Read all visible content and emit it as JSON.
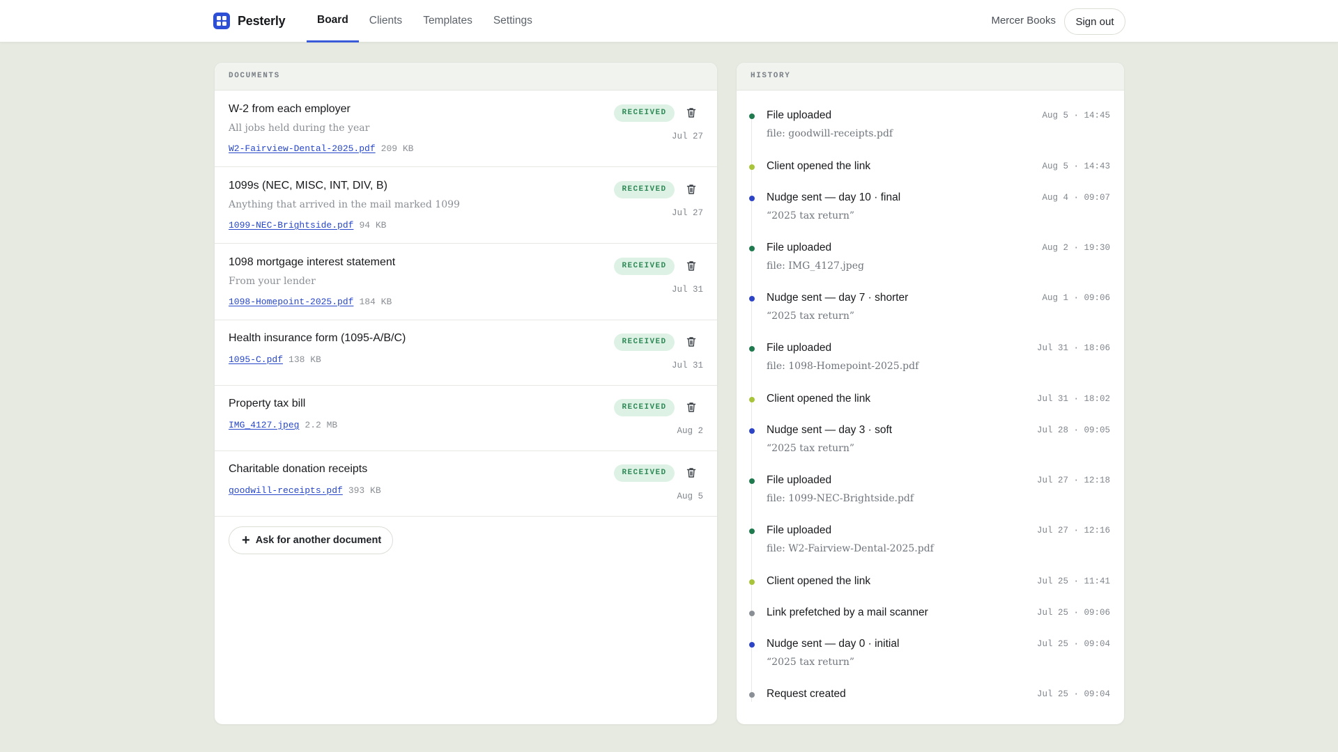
{
  "app": {
    "name": "Pesterly"
  },
  "nav": {
    "items": [
      {
        "label": "Board",
        "active": true
      },
      {
        "label": "Clients",
        "active": false
      },
      {
        "label": "Templates",
        "active": false
      },
      {
        "label": "Settings",
        "active": false
      }
    ],
    "account": "Mercer Books",
    "signout_label": "Sign out"
  },
  "documents": {
    "heading": "DOCUMENTS",
    "items": [
      {
        "title": "W-2 from each employer",
        "subtitle": "All jobs held during the year",
        "file": "W2-Fairview-Dental-2025.pdf",
        "size": "209 KB",
        "status": "RECEIVED",
        "date": "Jul 27"
      },
      {
        "title": "1099s (NEC, MISC, INT, DIV, B)",
        "subtitle": "Anything that arrived in the mail marked 1099",
        "file": "1099-NEC-Brightside.pdf",
        "size": "94 KB",
        "status": "RECEIVED",
        "date": "Jul 27"
      },
      {
        "title": "1098 mortgage interest statement",
        "subtitle": "From your lender",
        "file": "1098-Homepoint-2025.pdf",
        "size": "184 KB",
        "status": "RECEIVED",
        "date": "Jul 31"
      },
      {
        "title": "Health insurance form (1095-A/B/C)",
        "subtitle": "",
        "file": "1095-C.pdf",
        "size": "138 KB",
        "status": "RECEIVED",
        "date": "Jul 31"
      },
      {
        "title": "Property tax bill",
        "subtitle": "",
        "file": "IMG_4127.jpeg",
        "size": "2.2 MB",
        "status": "RECEIVED",
        "date": "Aug 2"
      },
      {
        "title": "Charitable donation receipts",
        "subtitle": "",
        "file": "goodwill-receipts.pdf",
        "size": "393 KB",
        "status": "RECEIVED",
        "date": "Aug 5"
      }
    ],
    "ask_label": "Ask for another document"
  },
  "history": {
    "heading": "HISTORY",
    "items": [
      {
        "title": "File uploaded",
        "detail": "file: goodwill-receipts.pdf",
        "time": "Aug 5 · 14:45",
        "kind": "upload"
      },
      {
        "title": "Client opened the link",
        "detail": "",
        "time": "Aug 5 · 14:43",
        "kind": "opened"
      },
      {
        "title": "Nudge sent — day 10 · final",
        "detail": "“2025 tax return”",
        "time": "Aug 4 · 09:07",
        "kind": "nudge"
      },
      {
        "title": "File uploaded",
        "detail": "file: IMG_4127.jpeg",
        "time": "Aug 2 · 19:30",
        "kind": "upload"
      },
      {
        "title": "Nudge sent — day 7 · shorter",
        "detail": "“2025 tax return”",
        "time": "Aug 1 · 09:06",
        "kind": "nudge"
      },
      {
        "title": "File uploaded",
        "detail": "file: 1098-Homepoint-2025.pdf",
        "time": "Jul 31 · 18:06",
        "kind": "upload"
      },
      {
        "title": "Client opened the link",
        "detail": "",
        "time": "Jul 31 · 18:02",
        "kind": "opened"
      },
      {
        "title": "Nudge sent — day 3 · soft",
        "detail": "“2025 tax return”",
        "time": "Jul 28 · 09:05",
        "kind": "nudge"
      },
      {
        "title": "File uploaded",
        "detail": "file: 1099-NEC-Brightside.pdf",
        "time": "Jul 27 · 12:18",
        "kind": "upload"
      },
      {
        "title": "File uploaded",
        "detail": "file: W2-Fairview-Dental-2025.pdf",
        "time": "Jul 27 · 12:16",
        "kind": "upload"
      },
      {
        "title": "Client opened the link",
        "detail": "",
        "time": "Jul 25 · 11:41",
        "kind": "opened"
      },
      {
        "title": "Link prefetched by a mail scanner",
        "detail": "",
        "time": "Jul 25 · 09:06",
        "kind": "system"
      },
      {
        "title": "Nudge sent — day 0 · initial",
        "detail": "“2025 tax return”",
        "time": "Jul 25 · 09:04",
        "kind": "nudge"
      },
      {
        "title": "Request created",
        "detail": "",
        "time": "Jul 25 · 09:04",
        "kind": "system"
      }
    ]
  },
  "colors": {
    "accent": "#3a5bd9",
    "upload": "#1f7a4d",
    "opened": "#a8c43a",
    "nudge": "#2d44c6",
    "system": "#8a8f95",
    "badge_bg": "#ddf2e5",
    "badge_fg": "#2f8a57"
  }
}
